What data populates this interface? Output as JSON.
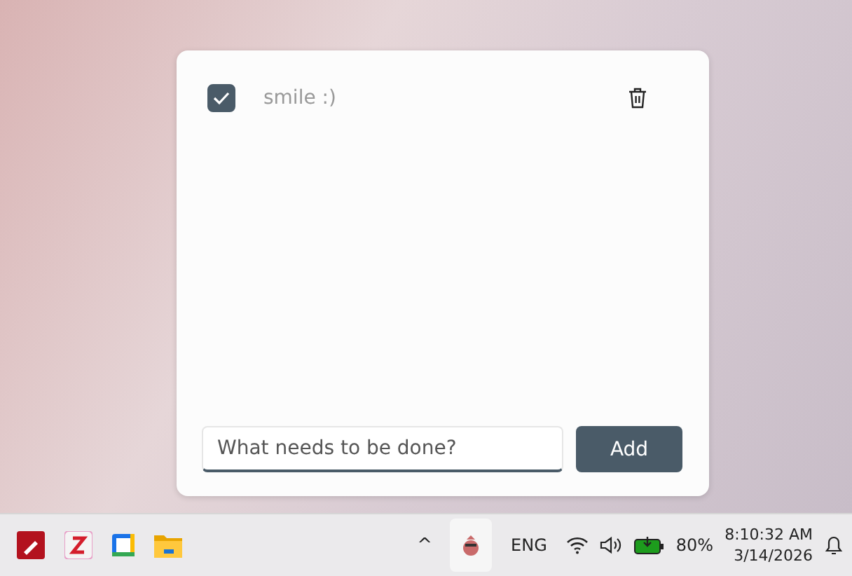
{
  "todos": [
    {
      "text": "smile :)",
      "checked": true
    }
  ],
  "new_todo": {
    "placeholder": "What needs to be done?",
    "button": "Add"
  },
  "taskbar": {
    "pinned_apps": [
      {
        "kind": "pdf"
      },
      {
        "kind": "z"
      },
      {
        "kind": "calendar"
      },
      {
        "kind": "folder"
      }
    ],
    "tray_caret": "^",
    "language": "ENG",
    "battery": "80%",
    "time": "8:10:32 AM",
    "date": "3/14/2026"
  }
}
